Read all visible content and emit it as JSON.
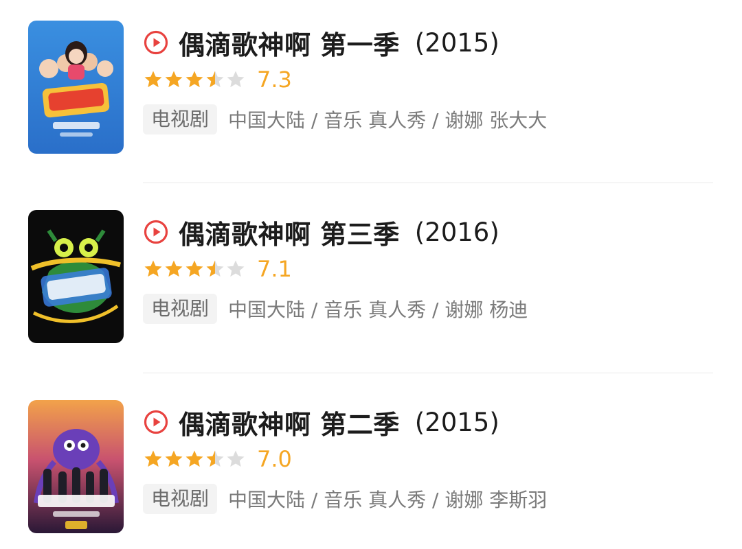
{
  "colors": {
    "accent_red": "#e8423f",
    "star_orange": "#f5a623",
    "star_grey": "#dcdcdc",
    "tag_bg": "#f3f3f3",
    "divider": "#e8e8e8"
  },
  "results": [
    {
      "title": "偶滴歌神啊 第一季",
      "year": "(2015)",
      "rating": 7.3,
      "rating_text": "7.3",
      "stars": [
        "full",
        "full",
        "full",
        "half",
        "empty"
      ],
      "tag": "电视剧",
      "meta": "中国大陆 / 音乐 真人秀 / 谢娜 张大大",
      "poster_icon": "poster-blue-icon"
    },
    {
      "title": "偶滴歌神啊 第三季",
      "year": "(2016)",
      "rating": 7.1,
      "rating_text": "7.1",
      "stars": [
        "full",
        "full",
        "full",
        "half",
        "empty"
      ],
      "tag": "电视剧",
      "meta": "中国大陆 / 音乐 真人秀 / 谢娜 杨迪",
      "poster_icon": "poster-black-icon"
    },
    {
      "title": "偶滴歌神啊 第二季",
      "year": "(2015)",
      "rating": 7.0,
      "rating_text": "7.0",
      "stars": [
        "full",
        "full",
        "full",
        "half",
        "empty"
      ],
      "tag": "电视剧",
      "meta": "中国大陆 / 音乐 真人秀 / 谢娜 李斯羽",
      "poster_icon": "poster-purple-icon"
    }
  ]
}
